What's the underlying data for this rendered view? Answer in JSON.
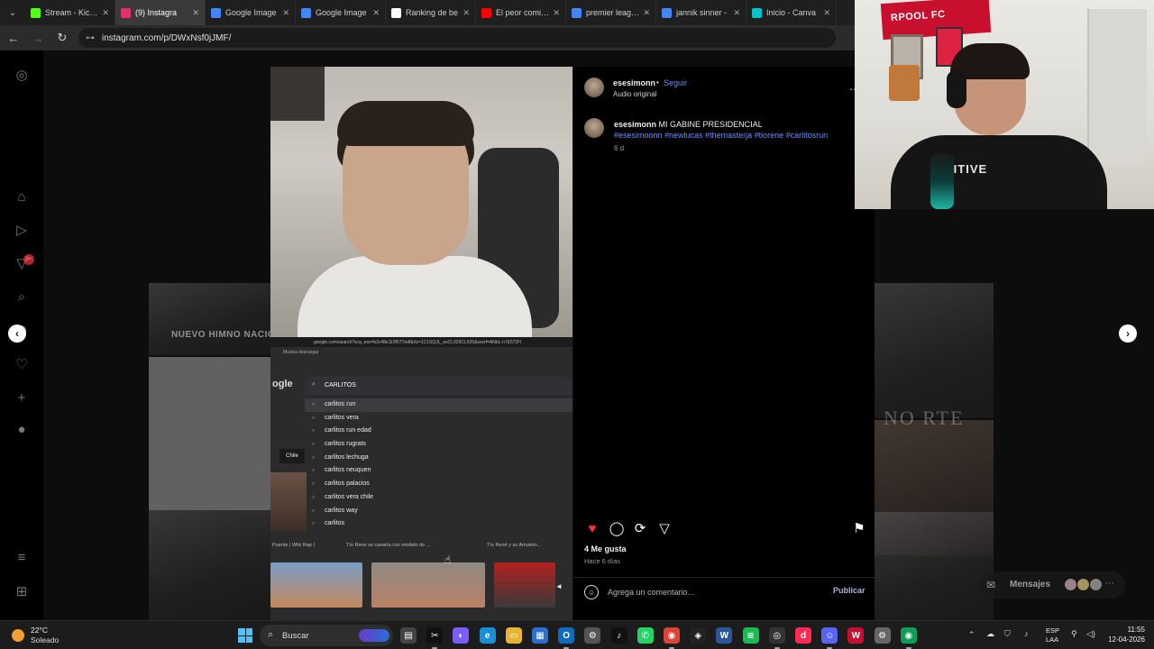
{
  "colors": {
    "accent_link": "#6d8dff",
    "like_heart": "#ff3040",
    "taskbar": "#1c1c1c",
    "windows_blue": "#4cc2ff"
  },
  "browser": {
    "tabs": [
      {
        "title": "Stream - Kick D",
        "fav_color": "#53fc18",
        "icon": "kick-icon"
      },
      {
        "title": "(9) Instagra",
        "fav_color": "#e1306c",
        "icon": "instagram-icon",
        "active": true
      },
      {
        "title": "Google Image",
        "fav_color": "#4285f4",
        "icon": "google-icon"
      },
      {
        "title": "Google Image",
        "fav_color": "#4285f4",
        "icon": "google-icon"
      },
      {
        "title": "Ranking de be",
        "fav_color": "#ffffff",
        "icon": "diamond-icon"
      },
      {
        "title": "El peor comien",
        "fav_color": "#ff0000",
        "icon": "youtube-icon"
      },
      {
        "title": "premier league",
        "fav_color": "#4285f4",
        "icon": "google-icon"
      },
      {
        "title": "jannik sinner -",
        "fav_color": "#4285f4",
        "icon": "google-icon"
      },
      {
        "title": "Inicio - Canva",
        "fav_color": "#00c4cc",
        "icon": "canva-icon"
      }
    ],
    "url": "instagram.com/p/DWxNsf0jJMF/"
  },
  "post": {
    "username": "esesimonn",
    "follow_label": "Seguir",
    "audio_label": "Audio original",
    "caption_user": "esesimonn",
    "caption_text": "MI GABINE PRESIDENCIAL",
    "caption_tags": "#esesimoonn #newlucas #themasterja #tiorene #carlitosrun",
    "caption_time": "6 d",
    "likes": "4 Me gusta",
    "posted_ago": "Hace 6 días",
    "comment_placeholder": "Agrega un comentario...",
    "publish_label": "Publicar"
  },
  "media": {
    "google_url": "google.com/search?sca_esv=b2c48e119f077edf&rlz=1C1SQJL_esCL925CL925&sxsrf=ANbL-n7E572H",
    "bookmark": "Musica descargar",
    "search_value": "CARLITOS",
    "suggestions": [
      "carlitos run",
      "carlitos vera",
      "carlitos run edad",
      "carlitos rugrats",
      "carlitos lechuga",
      "carlitos neuquen",
      "carlitos palacios",
      "carlitos vera chile",
      "carlitos way",
      "carlitos"
    ],
    "chile_label": "Chile",
    "links": [
      "Puente | Wiki Rap |",
      "Tío Rene se casaría con modelo de ...",
      "Tío René y su Amuleto..."
    ]
  },
  "background": {
    "anthem_text": "NUEVO HIMNO NACIO",
    "muerte_text": "NO RTE"
  },
  "messages": {
    "label": "Mensajes"
  },
  "streamer": {
    "flag_text": "RPOOL FC",
    "shirt_text": "SITIVE"
  },
  "taskbar": {
    "temp": "22°C",
    "condition": "Soleado",
    "search_label": "Buscar",
    "lang1": "ESP",
    "lang2": "LAA",
    "time": "11:55",
    "date": "12-04-2026"
  }
}
